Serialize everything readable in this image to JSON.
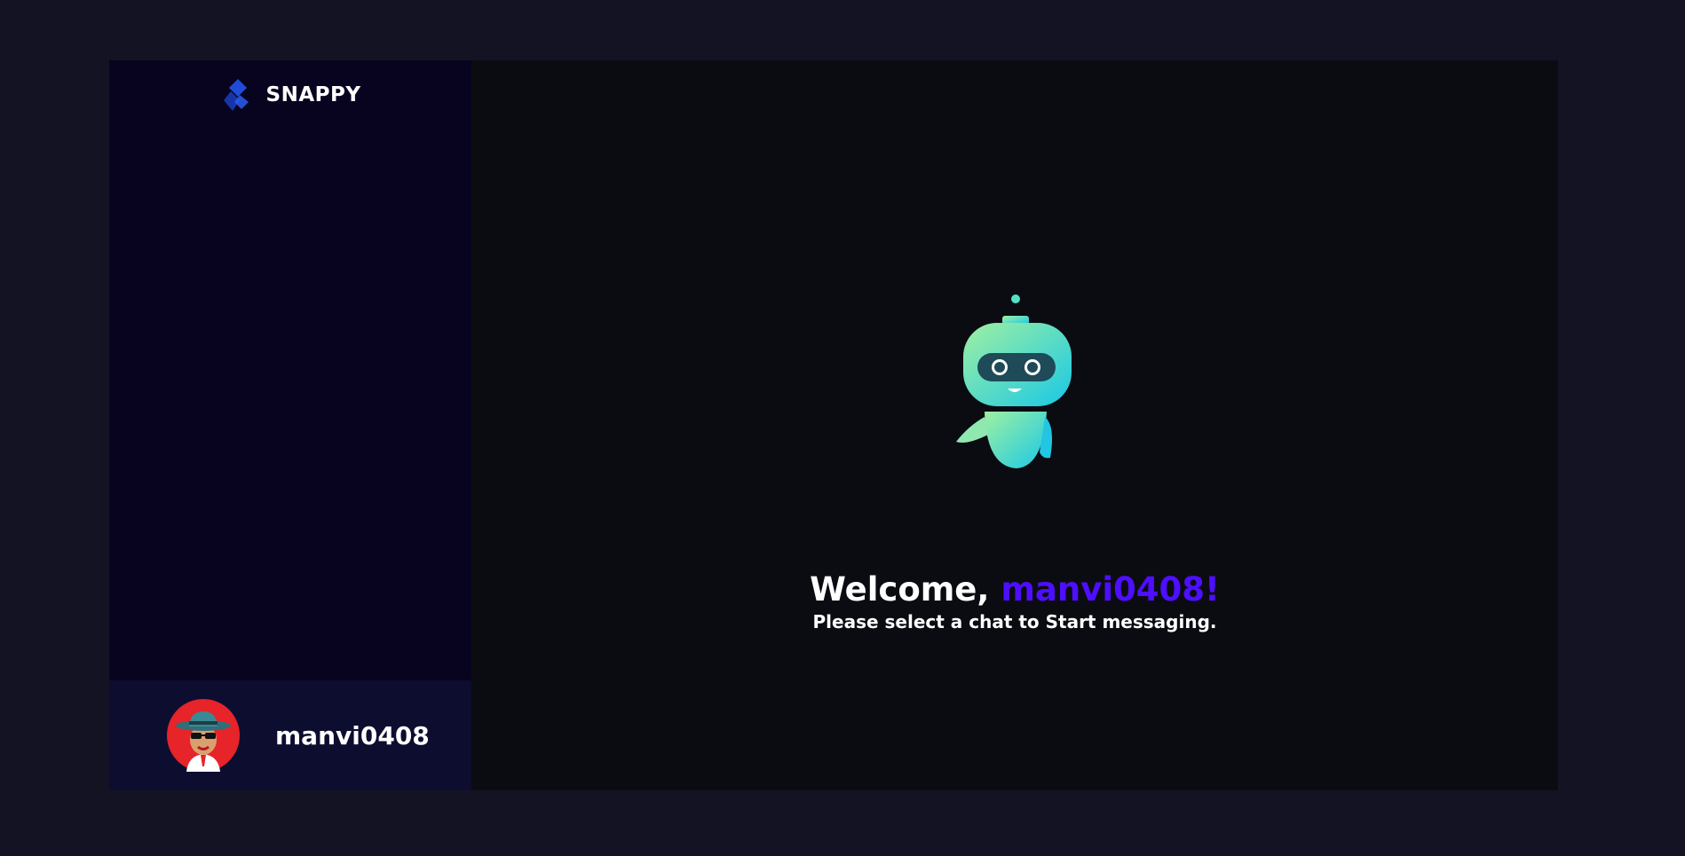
{
  "brand": {
    "name": "SNAPPY",
    "logo_icon": "snappy-logo-icon"
  },
  "sidebar": {
    "contacts": [],
    "current_user": {
      "username": "manvi0408",
      "avatar_icon": "detective-avatar-icon"
    }
  },
  "welcome": {
    "greeting": "Welcome, ",
    "username": "manvi0408!",
    "subtitle": "Please select a chat to Start messaging.",
    "illustration_icon": "robot-icon"
  },
  "colors": {
    "page_bg": "#131324",
    "sidebar_bg": "#080420",
    "user_panel_bg": "#0d0d30",
    "main_bg": "#0b0c12",
    "accent": "#4e0eff"
  }
}
